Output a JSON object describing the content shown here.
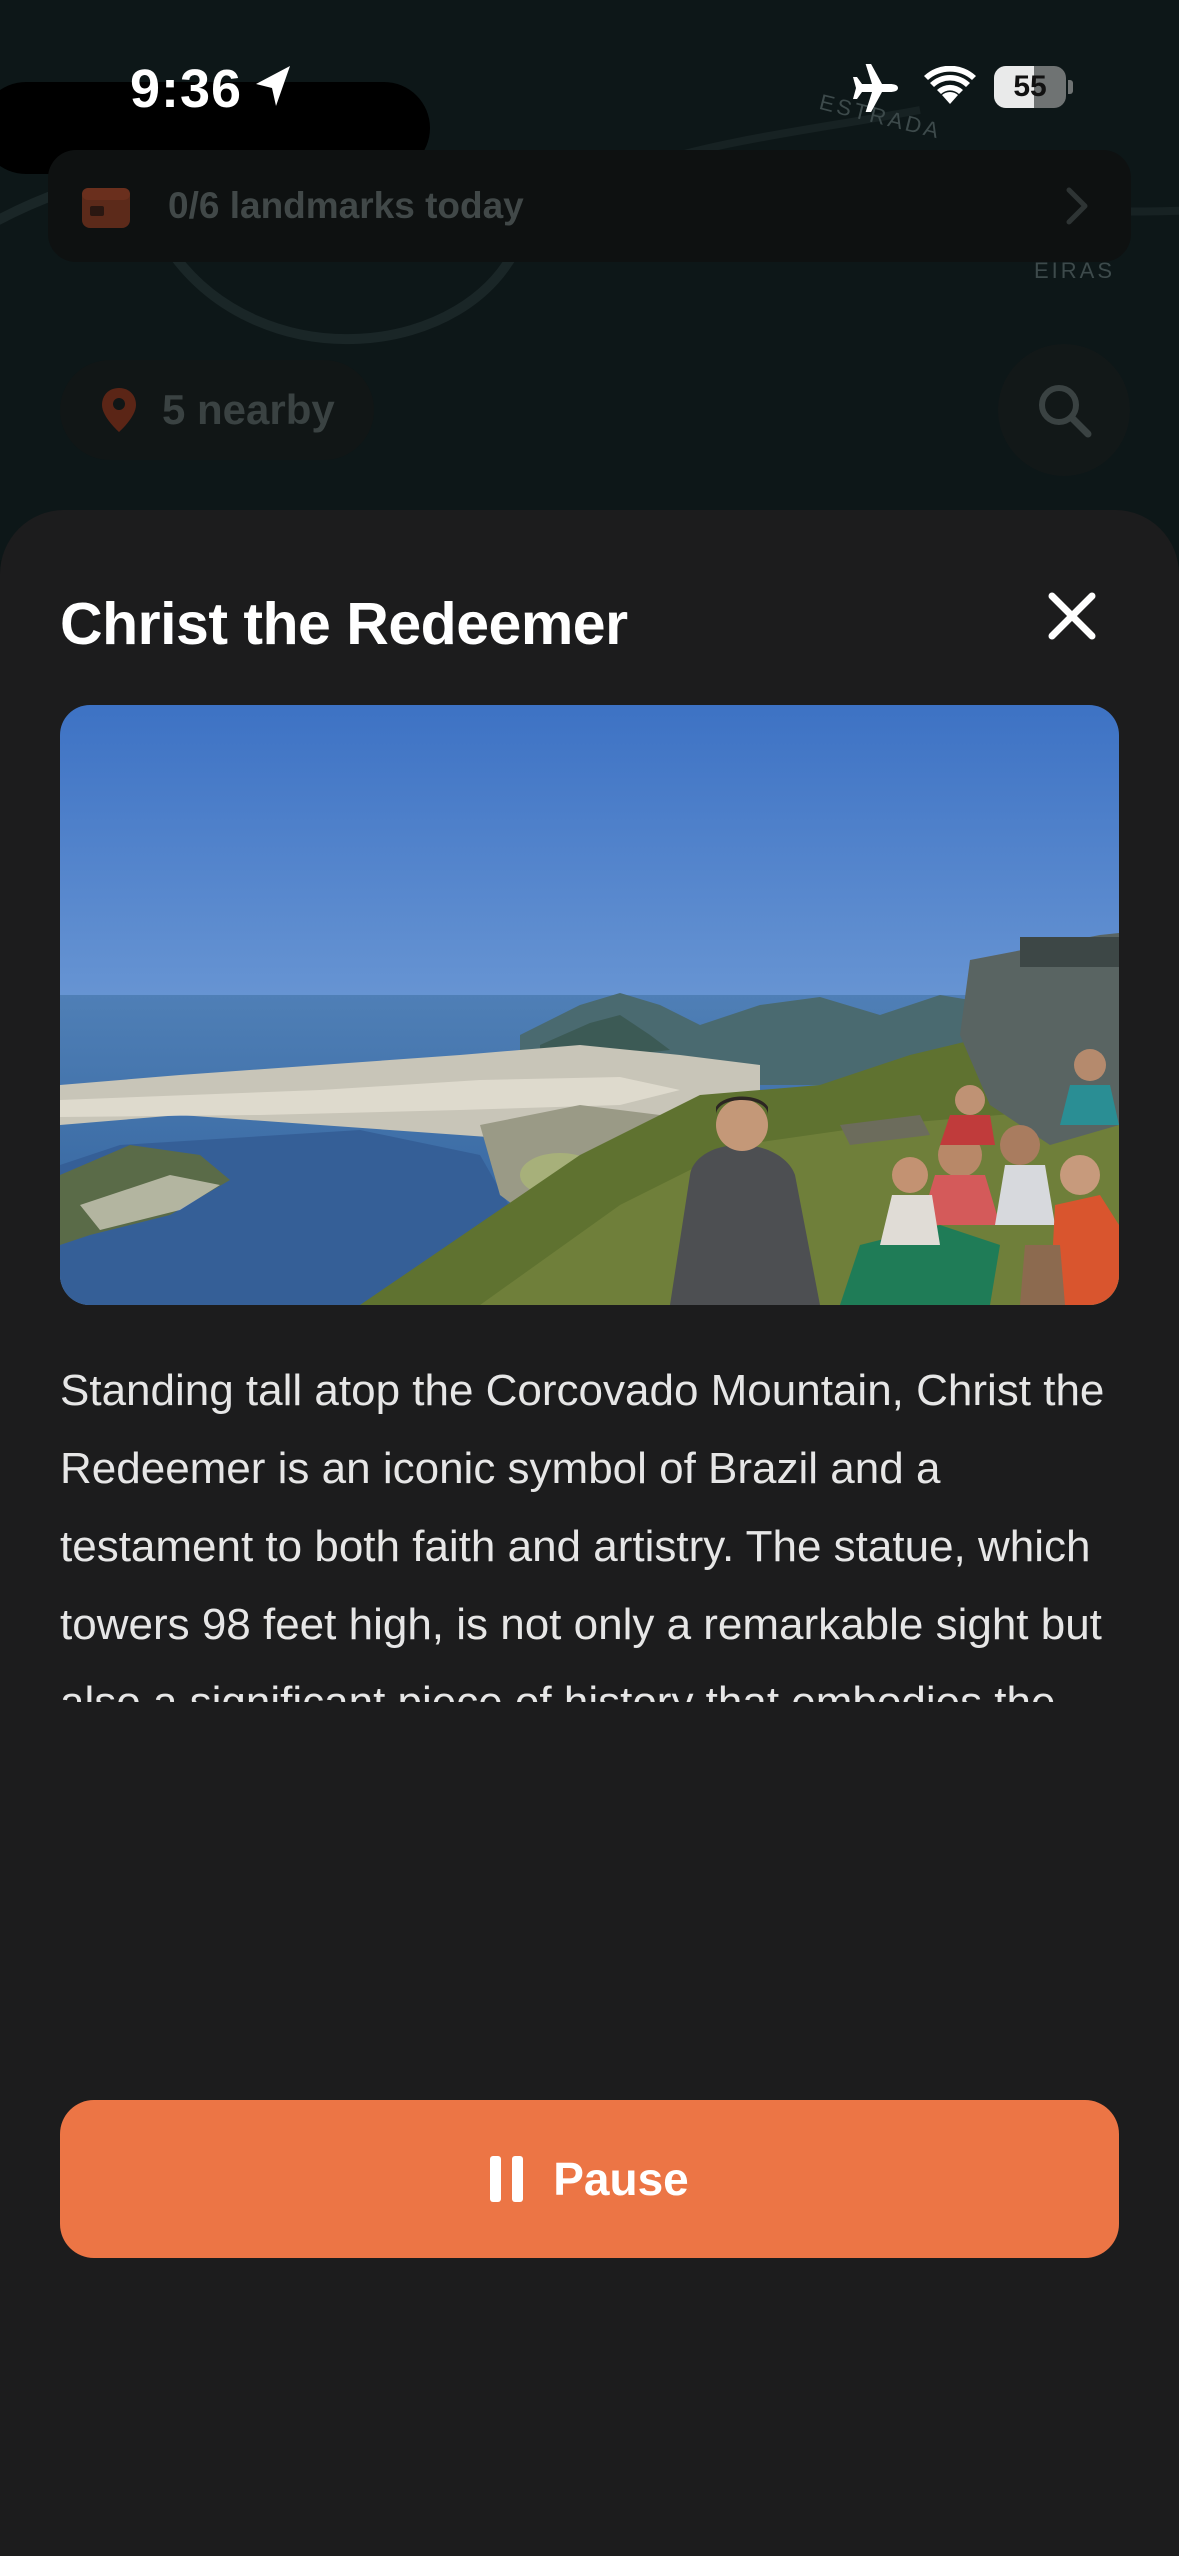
{
  "status_bar": {
    "time": "9:36",
    "battery_level": "55"
  },
  "map": {
    "road_labels": [
      "ESTRADA",
      "EIRAS"
    ]
  },
  "landmarks_banner": {
    "text": "0/6 landmarks today"
  },
  "nearby": {
    "label": "5 nearby"
  },
  "sheet": {
    "title": "Christ the Redeemer",
    "description": "Standing tall atop the Corcovado Mountain, Christ the Redeemer is an iconic symbol of Brazil and a testament to both faith and artistry. The statue, which towers 98 feet high, is not only a remarkable sight but also a significant piece of history that embodies the spirit of Rio de Janeiro. As you approach, the sheer scale of this statue, with its outstretched arms, evokes a sense of welcome and peace, inviting visitors",
    "pause_label": "Pause"
  },
  "colors": {
    "accent": "#ec7545",
    "sheet_bg": "#1c1c1d",
    "map_bg": "#0d1718"
  },
  "icons": {
    "location": "location-arrow-icon",
    "airplane": "airplane-icon",
    "wifi": "wifi-icon",
    "calendar": "calendar-icon",
    "chevron": "chevron-right-icon",
    "pin": "map-pin-icon",
    "search": "search-icon",
    "close": "close-icon",
    "pause": "pause-icon"
  }
}
